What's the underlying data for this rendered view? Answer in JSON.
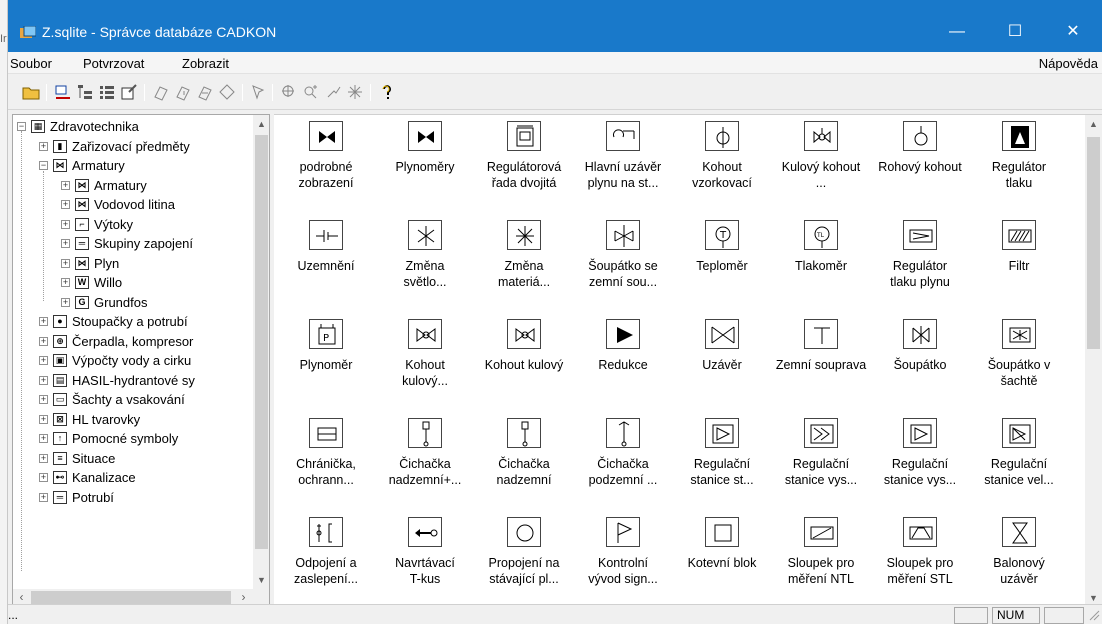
{
  "window": {
    "title": "Z.sqlite - Správce databáze CADKON"
  },
  "menu": {
    "file": "Soubor",
    "confirm": "Potvrzovat",
    "view": "Zobrazit",
    "help": "Nápověda"
  },
  "tree": {
    "items": [
      {
        "label": "Zdravotechnika",
        "level": 0,
        "icon": "category-icon"
      },
      {
        "label": "Zařizovací předměty",
        "level": 1,
        "icon": "fixture-icon"
      },
      {
        "label": "Armatury",
        "level": 1,
        "icon": "valve-icon",
        "expanded": true
      },
      {
        "label": "Armatury",
        "level": 2,
        "icon": "valve-icon"
      },
      {
        "label": "Vodovod litina",
        "level": 2,
        "icon": "valve-icon"
      },
      {
        "label": "Výtoky",
        "level": 2,
        "icon": "outlet-icon"
      },
      {
        "label": "Skupiny zapojení",
        "level": 2,
        "icon": "group-icon"
      },
      {
        "label": "Plyn",
        "level": 2,
        "icon": "valve-icon"
      },
      {
        "label": "Willo",
        "level": 2,
        "icon": "wilo-icon"
      },
      {
        "label": "Grundfos",
        "level": 2,
        "icon": "grundfos-icon"
      },
      {
        "label": "Stoupačky a potrubí",
        "level": 1,
        "icon": "riser-icon"
      },
      {
        "label": "Čerpadla, kompresor",
        "level": 1,
        "icon": "pump-icon"
      },
      {
        "label": "Výpočty vody a cirku",
        "level": 1,
        "icon": "calc-icon"
      },
      {
        "label": "HASIL-hydrantové sy",
        "level": 1,
        "icon": "hydrant-icon"
      },
      {
        "label": "Šachty a vsakování",
        "level": 1,
        "icon": "shaft-icon"
      },
      {
        "label": "HL tvarovky",
        "level": 1,
        "icon": "fitting-icon"
      },
      {
        "label": "Pomocné symboly",
        "level": 1,
        "icon": "helper-icon"
      },
      {
        "label": "Situace",
        "level": 1,
        "icon": "site-icon"
      },
      {
        "label": "Kanalizace",
        "level": 1,
        "icon": "sewer-icon"
      },
      {
        "label": "Potrubí",
        "level": 1,
        "icon": "pipe-icon"
      }
    ]
  },
  "grid": {
    "items": [
      {
        "label": "podrobné zobrazení",
        "icon": "bowtie-valve-icon"
      },
      {
        "label": "Plynoměry",
        "icon": "bowtie-valve-icon"
      },
      {
        "label": "Regulátorová řada dvojitá",
        "icon": "double-regulator-icon"
      },
      {
        "label": "Hlavní uzávěr plynu na st...",
        "icon": "main-gas-valve-icon"
      },
      {
        "label": "Kohout vzorkovací",
        "icon": "sampling-cock-icon"
      },
      {
        "label": "Kulový kohout ...",
        "icon": "ball-cock-icon"
      },
      {
        "label": "Rohový kohout",
        "icon": "corner-cock-icon"
      },
      {
        "label": "Regulátor tlaku",
        "icon": "pressure-regulator-icon"
      },
      {
        "label": "Uzemnění",
        "icon": "grounding-icon"
      },
      {
        "label": "Změna světlo...",
        "icon": "diameter-change-icon"
      },
      {
        "label": "Změna materiá...",
        "icon": "material-change-icon"
      },
      {
        "label": "Šoupátko se zemní sou...",
        "icon": "gate-valve-ground-icon"
      },
      {
        "label": "Teploměr",
        "icon": "thermometer-icon"
      },
      {
        "label": "Tlakoměr",
        "icon": "manometer-icon"
      },
      {
        "label": "Regulátor tlaku plynu",
        "icon": "gas-regulator-icon"
      },
      {
        "label": "Filtr",
        "icon": "filter-icon"
      },
      {
        "label": "Plynoměr",
        "icon": "gas-meter-icon"
      },
      {
        "label": "Kohout kulový...",
        "icon": "ball-valve-icon"
      },
      {
        "label": "Kohout kulový",
        "icon": "ball-valve-icon"
      },
      {
        "label": "Redukce",
        "icon": "reducer-icon"
      },
      {
        "label": "Uzávěr",
        "icon": "shutoff-icon"
      },
      {
        "label": "Zemní souprava",
        "icon": "ground-set-icon"
      },
      {
        "label": "Šoupátko",
        "icon": "gate-valve-icon"
      },
      {
        "label": "Šoupátko v šachtě",
        "icon": "gate-valve-shaft-icon"
      },
      {
        "label": "Chránička, ochrann...",
        "icon": "sleeve-icon"
      },
      {
        "label": "Čichačka nadzemní+...",
        "icon": "sniffer-icon"
      },
      {
        "label": "Čichačka nadzemní",
        "icon": "sniffer-icon"
      },
      {
        "label": "Čichačka podzemní ...",
        "icon": "sniffer-underground-icon"
      },
      {
        "label": "Regulační stanice st...",
        "icon": "regulation-station-icon"
      },
      {
        "label": "Regulační stanice vys...",
        "icon": "regulation-station-high-icon"
      },
      {
        "label": "Regulační stanice vys...",
        "icon": "regulation-station-icon"
      },
      {
        "label": "Regulační stanice vel...",
        "icon": "regulation-station-large-icon"
      },
      {
        "label": "Odpojení a zaslepení...",
        "icon": "disconnect-icon"
      },
      {
        "label": "Navrtávací T-kus",
        "icon": "tapping-tee-icon"
      },
      {
        "label": "Propojení na stávající pl...",
        "icon": "connection-circle-icon"
      },
      {
        "label": "Kontrolní vývod sign...",
        "icon": "control-outlet-flag-icon"
      },
      {
        "label": "Kotevní blok",
        "icon": "anchor-block-icon"
      },
      {
        "label": "Sloupek pro měření NTL",
        "icon": "measure-post-ntl-icon"
      },
      {
        "label": "Sloupek pro měření STL",
        "icon": "measure-post-stl-icon"
      },
      {
        "label": "Balonový uzávěr",
        "icon": "balloon-stopper-icon"
      }
    ]
  },
  "status": {
    "text": "...",
    "num": "NUM"
  }
}
